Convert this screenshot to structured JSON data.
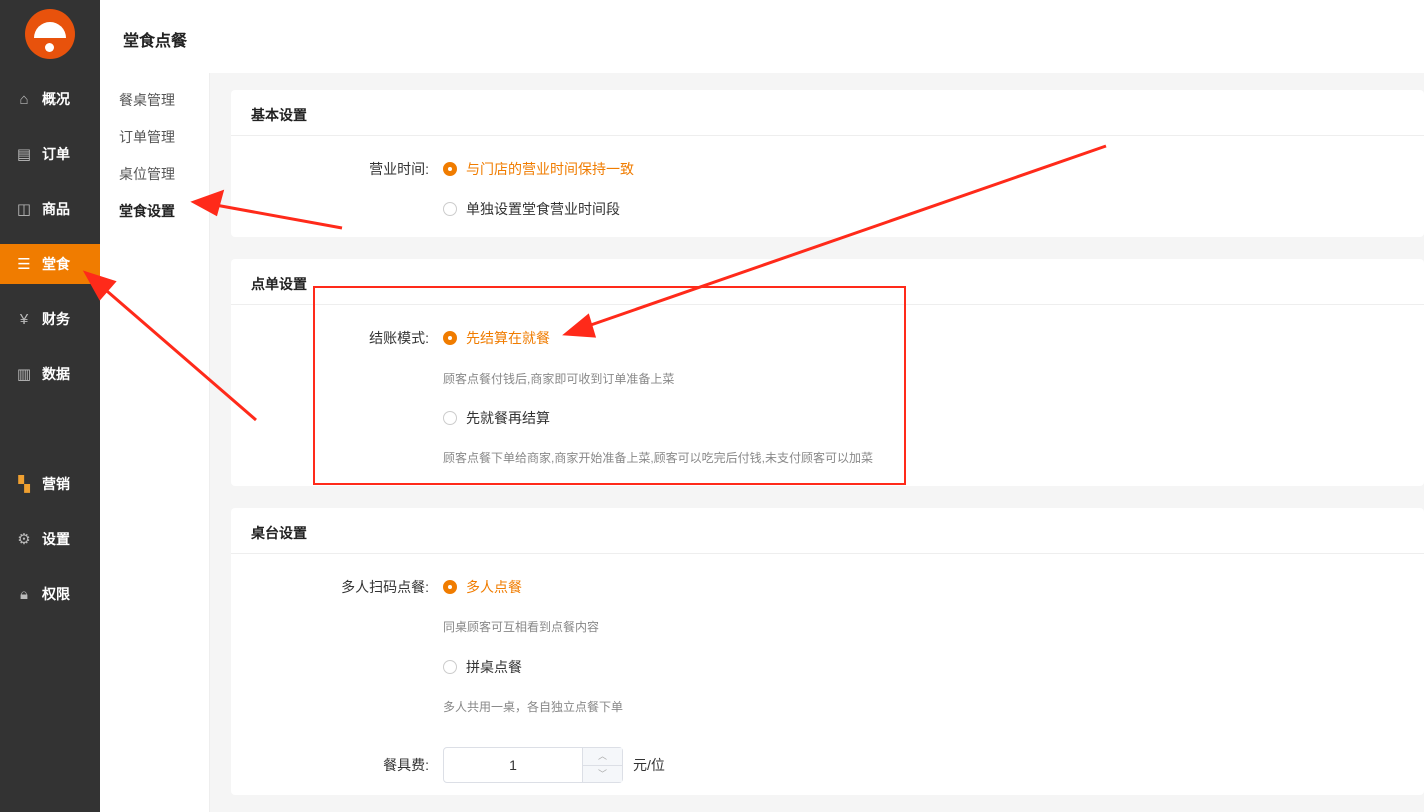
{
  "header": {
    "title": "堂食点餐"
  },
  "sidebar": {
    "items": [
      {
        "label": "概况",
        "icon": "home-icon"
      },
      {
        "label": "订单",
        "icon": "document-icon"
      },
      {
        "label": "商品",
        "icon": "bag-icon"
      },
      {
        "label": "堂食",
        "icon": "menu-icon",
        "active": true
      },
      {
        "label": "财务",
        "icon": "wallet-icon"
      },
      {
        "label": "数据",
        "icon": "bar-chart-icon"
      },
      {
        "label": "营销",
        "icon": "apps-icon"
      },
      {
        "label": "设置",
        "icon": "gear-icon"
      },
      {
        "label": "权限",
        "icon": "lock-icon"
      }
    ]
  },
  "subnav": {
    "items": [
      "餐桌管理",
      "订单管理",
      "桌位管理",
      "堂食设置"
    ],
    "active": "堂食设置"
  },
  "basic": {
    "title": "基本设置",
    "hours_label": "营业时间:",
    "opt1": "与门店的营业时间保持一致",
    "opt2": "单独设置堂食营业时间段"
  },
  "order": {
    "title": "点单设置",
    "mode_label": "结账模式:",
    "opt1": "先结算在就餐",
    "hint1": "顾客点餐付钱后,商家即可收到订单准备上菜",
    "opt2": "先就餐再结算",
    "hint2": "顾客点餐下单给商家,商家开始准备上菜,顾客可以吃完后付钱,未支付顾客可以加菜"
  },
  "table": {
    "title": "桌台设置",
    "multi_label": "多人扫码点餐:",
    "opt1": "多人点餐",
    "hint1": "同桌顾客可互相看到点餐内容",
    "opt2": "拼桌点餐",
    "hint2": "多人共用一桌，各自独立点餐下单",
    "fee_label": "餐具费:",
    "fee_value": "1",
    "fee_unit": "元/位"
  },
  "colors": {
    "accent": "#f07c00",
    "sidebar": "#333333",
    "annotation": "#ff2a1a"
  }
}
